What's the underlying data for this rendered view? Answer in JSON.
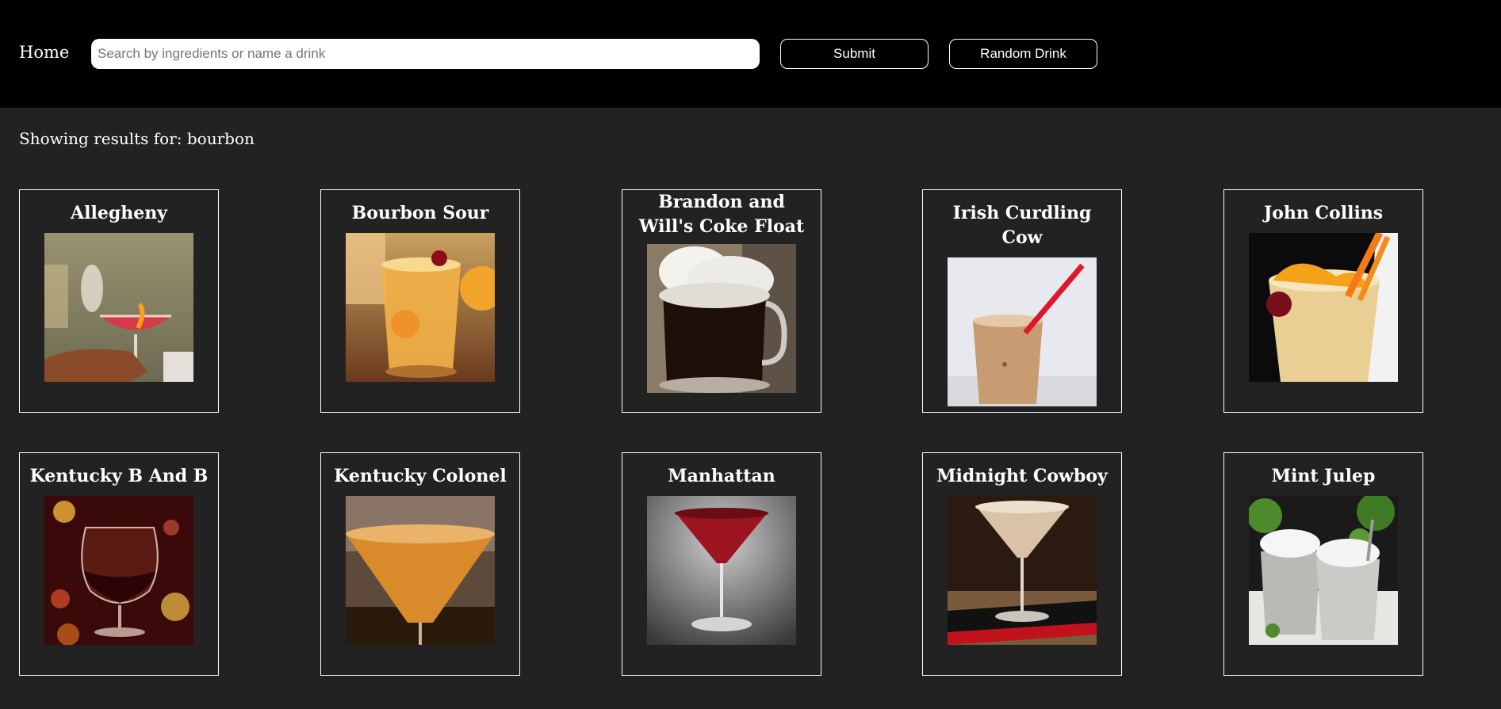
{
  "header": {
    "home_label": "Home",
    "search_placeholder": "Search by ingredients or name a drink",
    "submit_label": "Submit",
    "random_label": "Random Drink"
  },
  "results": {
    "label": "Showing results for: bourbon"
  },
  "drinks": [
    {
      "name": "Allegheny",
      "icon": "cocktail-glass-orange-twist-photo"
    },
    {
      "name": "Bourbon Sour",
      "icon": "rocks-glass-cherry-photo"
    },
    {
      "name": "Brandon and Will's Coke Float",
      "icon": "ice-cream-float-mug-photo"
    },
    {
      "name": "Irish Curdling Cow",
      "icon": "milky-drink-straw-photo"
    },
    {
      "name": "John Collins",
      "icon": "collins-glass-orange-cherry-photo"
    },
    {
      "name": "Kentucky B And B",
      "icon": "brandy-snifter-photo"
    },
    {
      "name": "Kentucky Colonel",
      "icon": "martini-glass-amber-photo"
    },
    {
      "name": "Manhattan",
      "icon": "martini-glass-red-photo"
    },
    {
      "name": "Midnight Cowboy",
      "icon": "martini-glass-cream-photo"
    },
    {
      "name": "Mint Julep",
      "icon": "julep-cups-mint-photo"
    }
  ],
  "colors": {
    "header_bg": "#000000",
    "page_bg": "#222222",
    "text": "#ffffff"
  }
}
